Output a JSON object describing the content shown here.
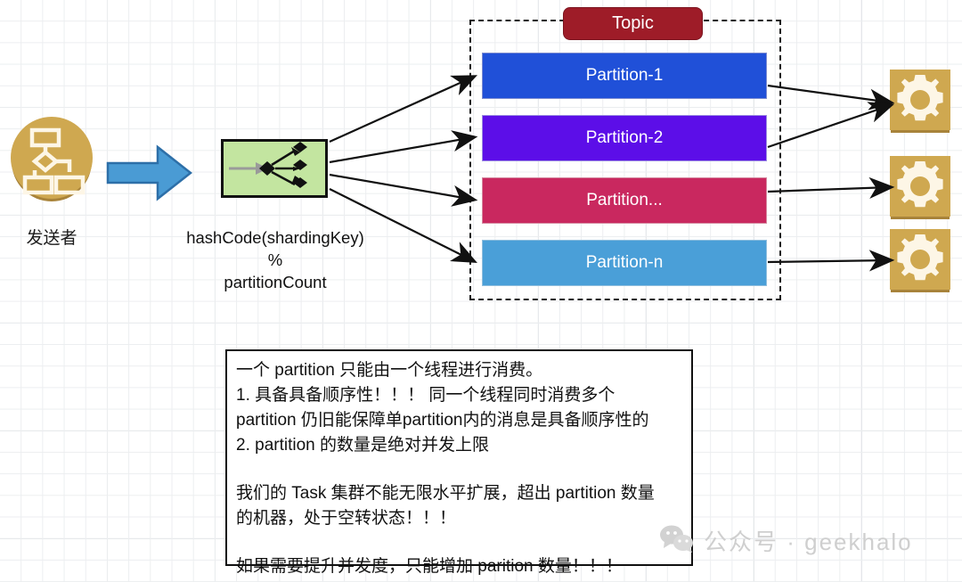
{
  "sender": {
    "label": "发送者",
    "icon": "flowchart-icon",
    "color": "#cfa850"
  },
  "flow_arrow": {
    "icon": "right-arrow-icon",
    "fill": "#4a9bd4",
    "stroke": "#2d6fa8"
  },
  "hash": {
    "icon": "fanout-diamond-icon",
    "box_color": "#c3e5a0",
    "label_line1": "hashCode(shardingKey)",
    "label_line2": "%",
    "label_line3": "partitionCount"
  },
  "topic": {
    "badge_label": "Topic",
    "badge_color": "#9e1c28",
    "partitions": [
      {
        "label": "Partition-1",
        "color": "#2050d8"
      },
      {
        "label": "Partition-2",
        "color": "#5c0ee8"
      },
      {
        "label": "Partition...",
        "color": "#c9285f"
      },
      {
        "label": "Partition-n",
        "color": "#4a9fd8"
      }
    ]
  },
  "consumers": [
    {
      "icon": "gear-icon",
      "color": "#cfa850"
    },
    {
      "icon": "gear-icon",
      "color": "#cfa850"
    },
    {
      "icon": "gear-icon",
      "color": "#cfa850"
    }
  ],
  "note": {
    "lines": [
      "一个 partition 只能由一个线程进行消费。",
      "1. 具备具备顺序性！！！ 同一个线程同时消费多个",
      "partition 仍旧能保障单partition内的消息是具备顺序性的",
      "2. partition 的数量是绝对并发上限",
      "",
      "我们的 Task 集群不能无限水平扩展，超出 partition 数量",
      "的机器，处于空转状态！！！",
      "",
      "如果需要提升并发度，只能增加 parition 数量！！！"
    ]
  },
  "watermark": {
    "icon": "wechat-icon",
    "text": "公众号 · geekhalo",
    "color": "#cfcfcf"
  }
}
